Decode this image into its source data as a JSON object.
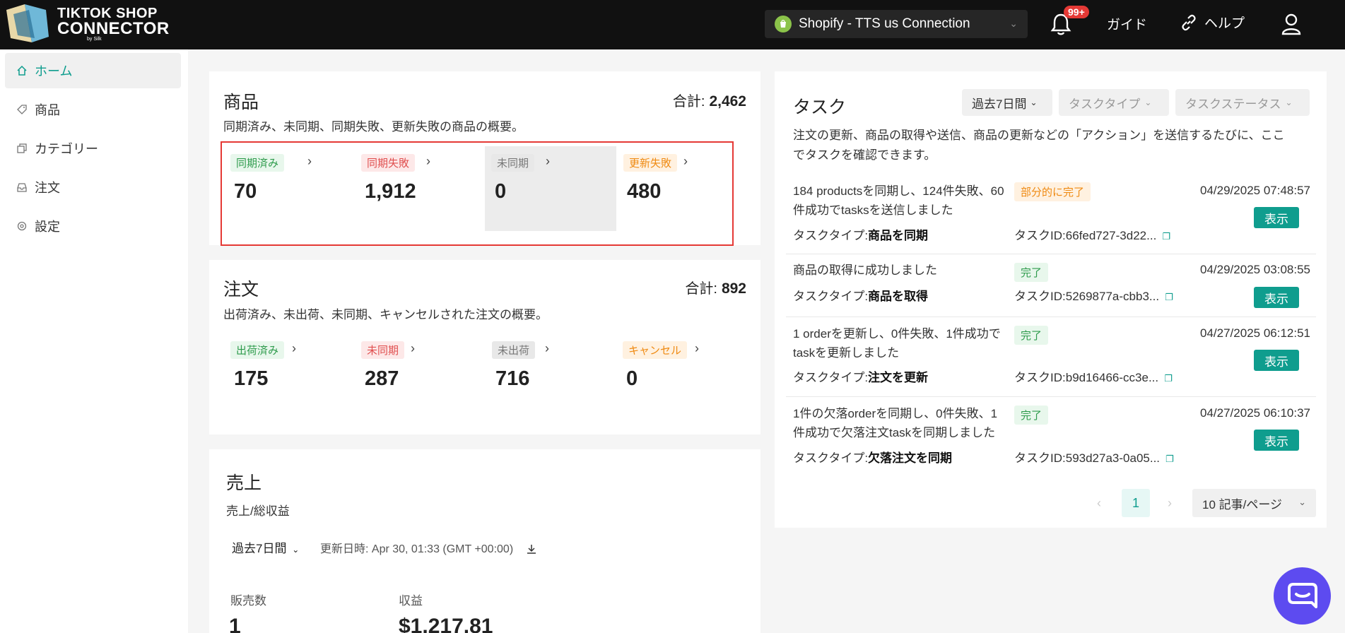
{
  "brand": {
    "line1": "TIKTOK SHOP",
    "line2": "CONNECTOR",
    "sub": "by Silk"
  },
  "topbar": {
    "store_label": "Shopify - TTS us Connection",
    "notification_count": "99+",
    "guide_label": "ガイド",
    "help_label": "ヘルプ"
  },
  "sidebar": {
    "items": [
      {
        "label": "ホーム",
        "icon": "home-icon",
        "active": true
      },
      {
        "label": "商品",
        "icon": "tag-icon"
      },
      {
        "label": "カテゴリー",
        "icon": "copy-icon"
      },
      {
        "label": "注文",
        "icon": "inbox-icon"
      },
      {
        "label": "設定",
        "icon": "gear-icon"
      }
    ]
  },
  "products": {
    "title": "商品",
    "total_label": "合計:",
    "total": "2,462",
    "desc": "同期済み、未同期、同期失敗、更新失敗の商品の概要。",
    "stats": [
      {
        "label": "同期済み",
        "value": "70",
        "color": "green"
      },
      {
        "label": "同期失敗",
        "value": "1,912",
        "color": "red"
      },
      {
        "label": "未同期",
        "value": "0",
        "color": "gray"
      },
      {
        "label": "更新失敗",
        "value": "480",
        "color": "orange"
      }
    ]
  },
  "orders": {
    "title": "注文",
    "total_label": "合計:",
    "total": "892",
    "desc": "出荷済み、未出荷、未同期、キャンセルされた注文の概要。",
    "stats": [
      {
        "label": "出荷済み",
        "value": "175",
        "color": "green"
      },
      {
        "label": "未同期",
        "value": "287",
        "color": "red"
      },
      {
        "label": "未出荷",
        "value": "716",
        "color": "gray"
      },
      {
        "label": "キャンセル",
        "value": "0",
        "color": "orange"
      }
    ]
  },
  "sales": {
    "title": "売上",
    "desc": "売上/総収益",
    "period": "過去7日間",
    "updated": "更新日時:  Apr 30, 01:33 (GMT +00:00)",
    "units_label": "販売数",
    "units_value": "1",
    "revenue_label": "収益",
    "revenue_value": "$1,217.81"
  },
  "tasks": {
    "title": "タスク",
    "filter_period": "過去7日間",
    "filter_type": "タスクタイプ",
    "filter_status": "タスクステータス",
    "desc_line1": "注文の更新、商品の取得や送信、商品の更新などの「アクション」を送信するたびに、ここ",
    "desc_line2": "でタスクを確認できます。",
    "type_label": "タスクタイプ:",
    "id_label": "タスクID:",
    "show_label": "表示",
    "rows": [
      {
        "line1": "184 productsを同期し、124件失敗、60",
        "line2": "件成功でtasksを送信しました",
        "status": "部分的に完了",
        "status_color": "orange",
        "time": "04/29/2025 07:48:57",
        "type": "商品を同期",
        "id": "66fed727-3d22..."
      },
      {
        "line1": "商品の取得に成功しました",
        "line2": "",
        "status": "完了",
        "status_color": "green",
        "time": "04/29/2025 03:08:55",
        "type": "商品を取得",
        "id": "5269877a-cbb3..."
      },
      {
        "line1": "1 orderを更新し、0件失敗、1件成功で",
        "line2": "taskを更新しました",
        "status": "完了",
        "status_color": "green",
        "time": "04/27/2025 06:12:51",
        "type": "注文を更新",
        "id": "b9d16466-cc3e..."
      },
      {
        "line1": "1件の欠落orderを同期し、0件失敗、1",
        "line2": "件成功で欠落注文taskを同期しました",
        "status": "完了",
        "status_color": "green",
        "time": "04/27/2025 06:10:37",
        "type": "欠落注文を同期",
        "id": "593d27a3-0a05..."
      }
    ],
    "page": "1",
    "page_size": "10 記事/ページ"
  }
}
